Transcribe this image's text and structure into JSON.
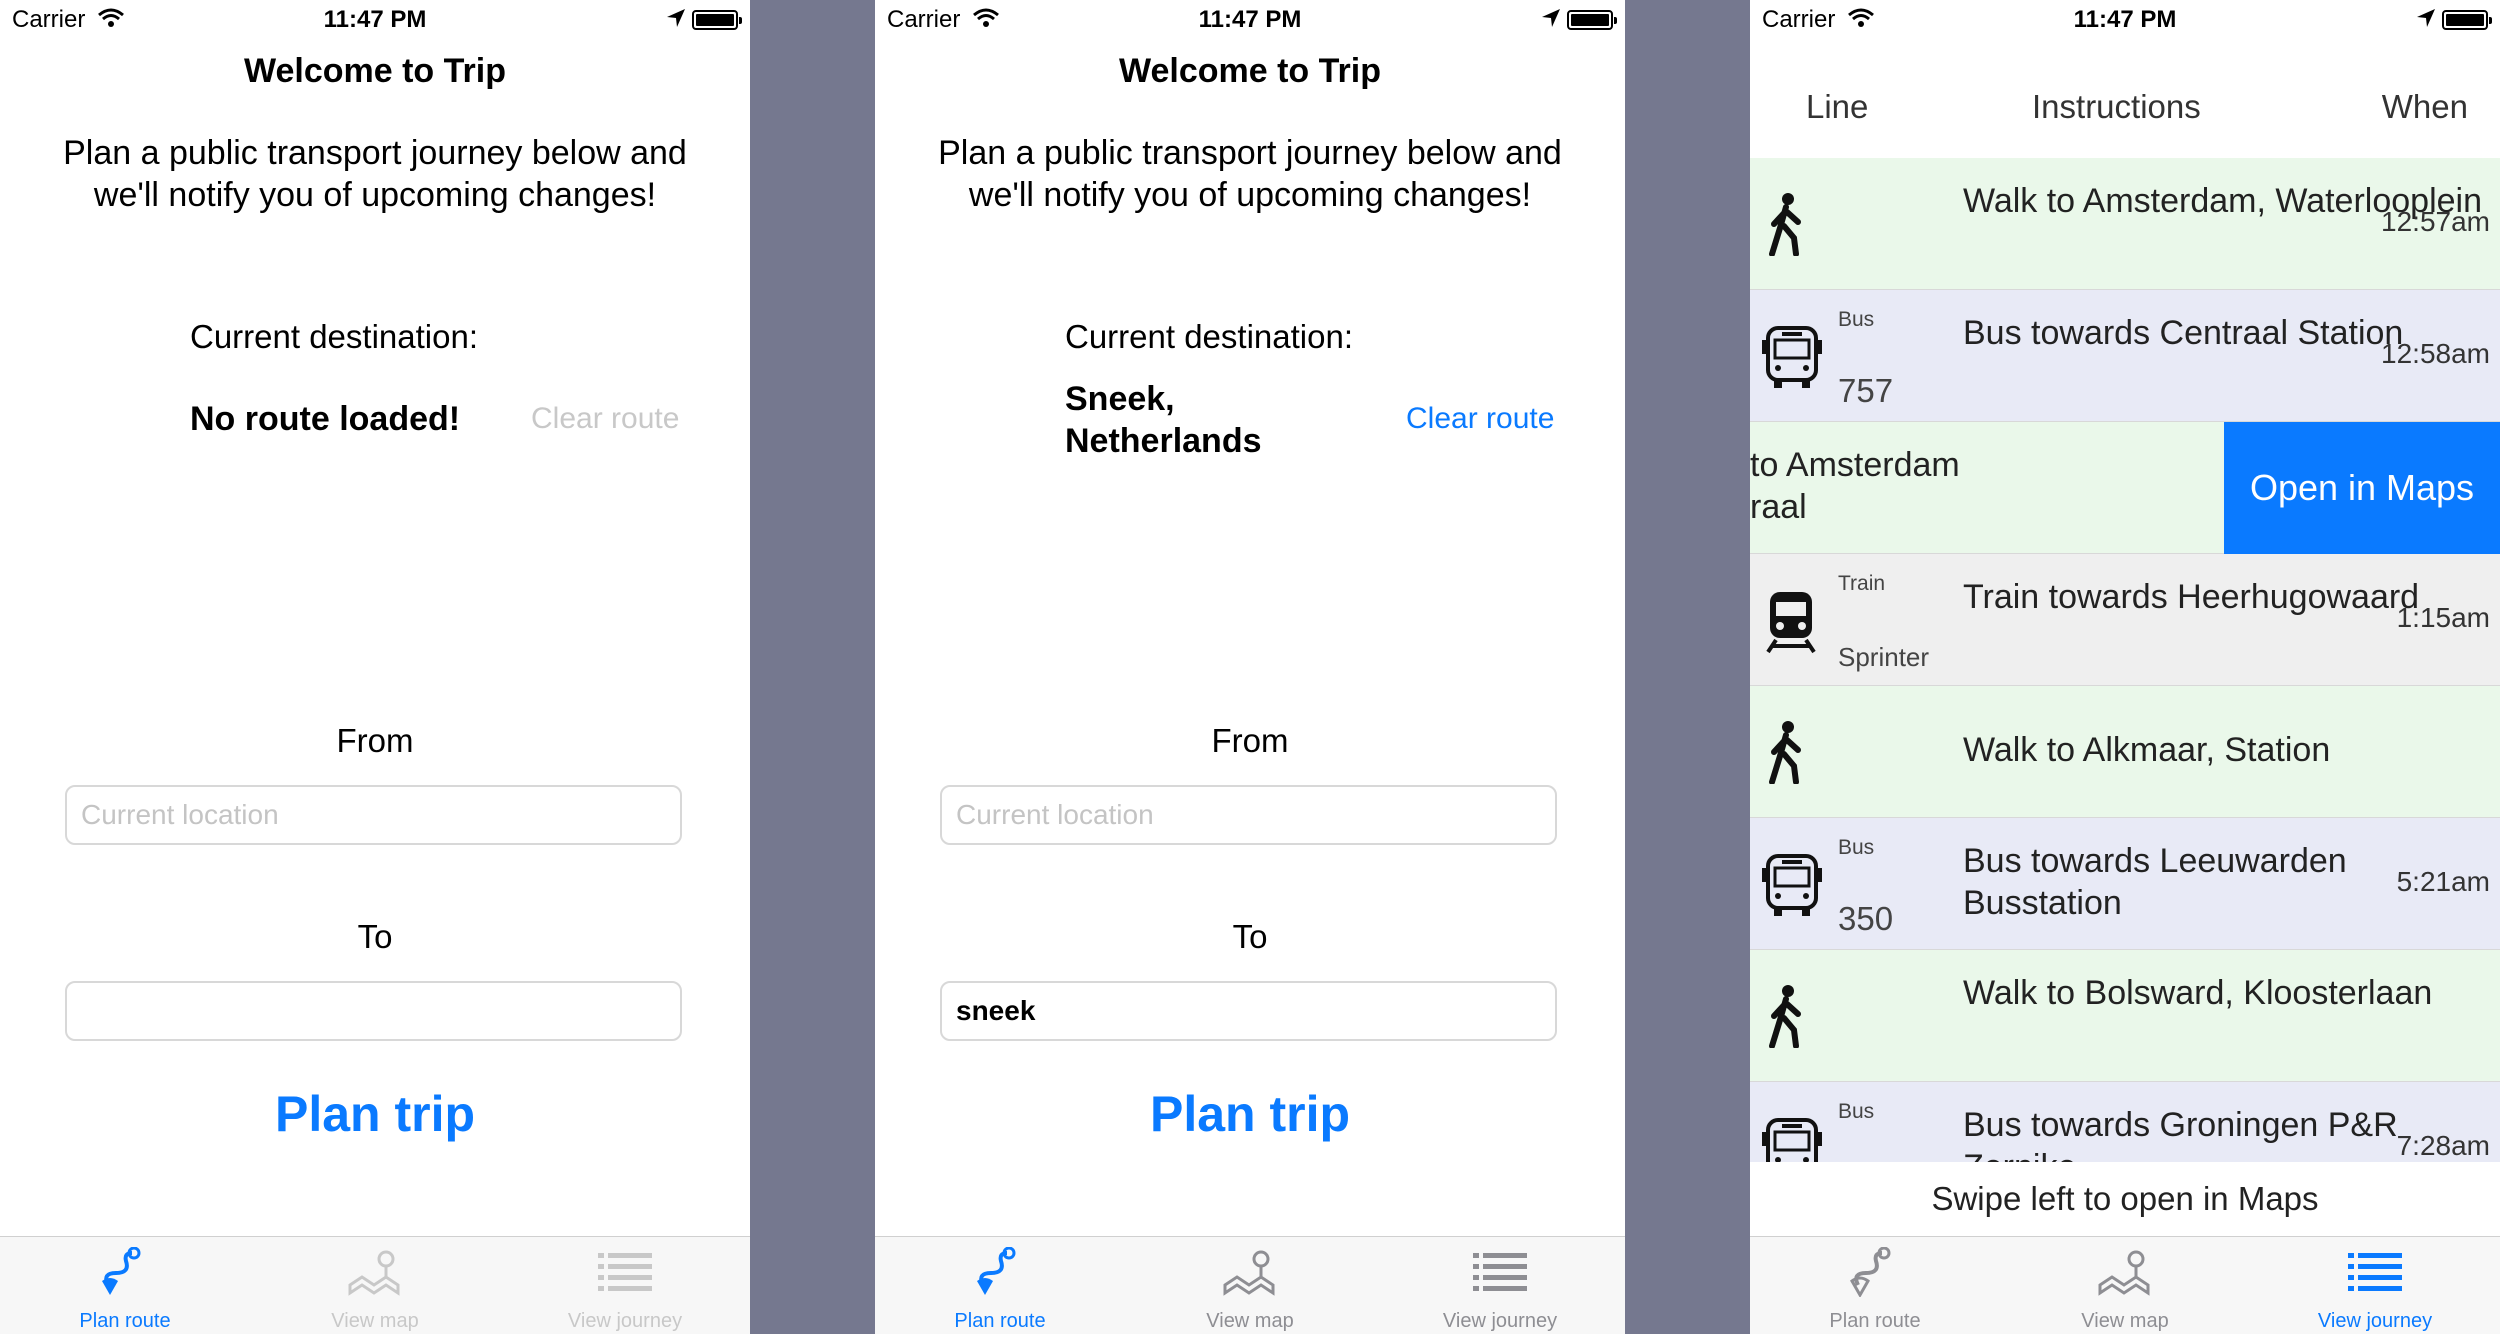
{
  "status": {
    "carrier": "Carrier",
    "time": "11:47 PM"
  },
  "colors": {
    "accent": "#0a7aff",
    "walk_row": "#eaf8ea",
    "bus_row": "#e8eaf6",
    "train_row": "#efefef",
    "background": "#75788f"
  },
  "plan": {
    "title": "Welcome to Trip",
    "subtitle": "Plan a public transport journey below and we'll notify you of upcoming changes!",
    "current_destination_label": "Current destination:",
    "clear_route_label": "Clear route",
    "from_label": "From",
    "from_placeholder": "Current location",
    "to_label": "To",
    "plan_button": "Plan trip"
  },
  "screen1": {
    "destination": "No route loaded!",
    "to_value": ""
  },
  "screen2": {
    "destination": "Sneek, Netherlands",
    "to_value": "sneek"
  },
  "tabs": [
    {
      "label": "Plan route",
      "icon": "route-icon"
    },
    {
      "label": "View map",
      "icon": "map-icon"
    },
    {
      "label": "View journey",
      "icon": "list-icon"
    }
  ],
  "journey": {
    "headers": {
      "line": "Line",
      "instructions": "Instructions",
      "when": "When"
    },
    "rows": [
      {
        "type": "walk",
        "icon": "walk-icon",
        "instruction": "Walk to Amsterdam, Waterlooplein",
        "time": "12:57am"
      },
      {
        "type": "bus",
        "icon": "bus-icon",
        "mode": "Bus",
        "line": "757",
        "instruction": "Bus towards Centraal Station",
        "time": "12:58am"
      },
      {
        "type": "walk",
        "icon": "walk-icon",
        "instruction": "to Amsterdam raal",
        "time": ""
      },
      {
        "type": "train",
        "icon": "train-icon",
        "mode": "Train",
        "line": "Sprinter",
        "instruction": "Train towards Heerhugowaard",
        "time": "1:15am"
      },
      {
        "type": "walk",
        "icon": "walk-icon",
        "instruction": "Walk to Alkmaar, Station",
        "time": ""
      },
      {
        "type": "bus",
        "icon": "bus-icon",
        "mode": "Bus",
        "line": "350",
        "instruction": "Bus towards Leeuwarden Busstation",
        "time": "5:21am"
      },
      {
        "type": "walk",
        "icon": "walk-icon",
        "instruction": "Walk to Bolsward, Kloosterlaan",
        "time": ""
      },
      {
        "type": "bus",
        "icon": "bus-icon",
        "mode": "Bus",
        "line": "",
        "instruction": "Bus towards Groningen P&R Zernike",
        "time": "7:28am"
      }
    ],
    "open_in_maps": "Open in Maps",
    "hint": "Swipe left to open in Maps"
  }
}
